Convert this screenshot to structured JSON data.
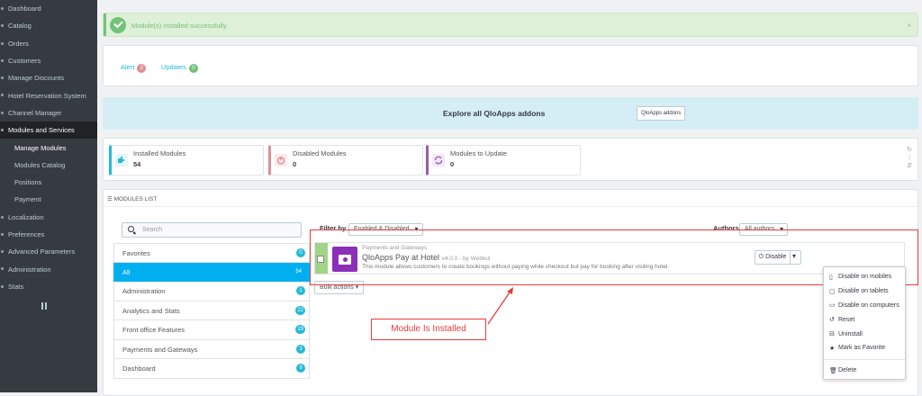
{
  "sidebar": {
    "items": [
      {
        "label": "Dashboard"
      },
      {
        "label": "Catalog"
      },
      {
        "label": "Orders"
      },
      {
        "label": "Customers"
      },
      {
        "label": "Manage Discounts"
      },
      {
        "label": "Hotel Reservation System"
      },
      {
        "label": "Channel Manager"
      },
      {
        "label": "Modules and Services",
        "active": true
      },
      {
        "label": "Manage Modules",
        "sub": true,
        "current": true
      },
      {
        "label": "Modules Catalog",
        "sub": true
      },
      {
        "label": "Positions",
        "sub": true
      },
      {
        "label": "Payment",
        "sub": true
      },
      {
        "label": "Localization"
      },
      {
        "label": "Preferences"
      },
      {
        "label": "Advanced Parameters"
      },
      {
        "label": "Administration"
      },
      {
        "label": "Stats"
      }
    ]
  },
  "alert": {
    "message": "Module(s) installed successfully.",
    "close": "×"
  },
  "tabs": {
    "alert_label": "Alert",
    "alert_count": "2",
    "updates_label": "Updates",
    "updates_count": "0"
  },
  "explore": {
    "text": "Explore all QloApps addons",
    "button": "QloApps addons"
  },
  "kpis": [
    {
      "label": "Installed Modules",
      "value": "54"
    },
    {
      "label": "Disabled Modules",
      "value": "0"
    },
    {
      "label": "Modules to Update",
      "value": "0"
    }
  ],
  "modules_list": {
    "heading": "MODULES LIST",
    "search_placeholder": "Search",
    "filter_label": "Filter by",
    "filter_value": "Enabled & Disabled",
    "authors_label": "Authors",
    "authors_value": "All authors",
    "categories": [
      {
        "name": "Favorites",
        "count": "0"
      },
      {
        "name": "All",
        "count": "54",
        "active": true
      },
      {
        "name": "Administration",
        "count": "1"
      },
      {
        "name": "Analytics and Stats",
        "count": "22"
      },
      {
        "name": "Front office Features",
        "count": "19"
      },
      {
        "name": "Payments and Gateways",
        "count": "3"
      },
      {
        "name": "Dashboard",
        "count": "9"
      }
    ],
    "module": {
      "category": "Payments and Gateways",
      "name": "QloApps Pay at Hotel",
      "version": "v4.0.0 - by Webkul",
      "description": "This module allows customers to create bookings without paying while checkout but pay for booking after visiting hotel."
    },
    "disable_button": "Disable",
    "bulk_actions": "Bulk actions"
  },
  "dropdown": [
    {
      "label": "Disable on mobiles",
      "icon": "mobile-icon"
    },
    {
      "label": "Disable on tablets",
      "icon": "tablet-icon"
    },
    {
      "label": "Disable on computers",
      "icon": "desktop-icon"
    },
    {
      "label": "Reset",
      "icon": "undo-icon"
    },
    {
      "label": "Uninstall",
      "icon": "minus-icon"
    },
    {
      "label": "Mark as Favorite",
      "icon": "star-icon"
    },
    {
      "label": "Delete",
      "icon": "trash-icon"
    }
  ],
  "annotation": {
    "text": "Module Is Installed",
    "color": "#e83b3b"
  },
  "colors": {
    "accent": "#25b9d7",
    "success": "#72c279",
    "danger": "#e08f95",
    "sidebar": "#363a41"
  }
}
